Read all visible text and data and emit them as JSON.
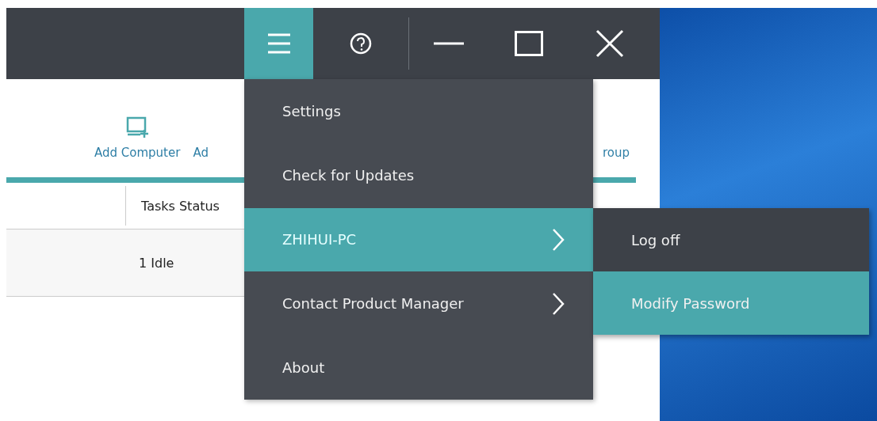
{
  "title_bar": {
    "buttons": [
      {
        "kind": "menu",
        "selected": true
      },
      {
        "kind": "help",
        "selected": false
      },
      {
        "kind": "minimize",
        "selected": false
      },
      {
        "kind": "maximize",
        "selected": false
      },
      {
        "kind": "close",
        "selected": false
      }
    ]
  },
  "toolbar": {
    "items": [
      {
        "label": "Add Computer",
        "kind": "icon"
      },
      {
        "label": "Ad",
        "kind": "covered"
      },
      {
        "label": "roup",
        "kind": "covered"
      }
    ]
  },
  "table": {
    "columns": [
      "Tasks Status"
    ],
    "rows": [
      [
        "1 Idle"
      ]
    ]
  },
  "menu": {
    "items": [
      {
        "label": "Settings",
        "kind": "plain",
        "selected": false
      },
      {
        "label": "Check for Updates",
        "kind": "plain",
        "selected": false
      },
      {
        "label": "ZHIHUI-PC",
        "kind": "submenu",
        "selected": true
      },
      {
        "label": "Contact Product Manager",
        "kind": "submenu",
        "selected": false
      },
      {
        "label": "About",
        "kind": "plain",
        "selected": false
      }
    ]
  },
  "submenu": {
    "items": [
      {
        "label": "Log off",
        "selected": false
      },
      {
        "label": "Modify Password",
        "selected": true
      }
    ]
  }
}
